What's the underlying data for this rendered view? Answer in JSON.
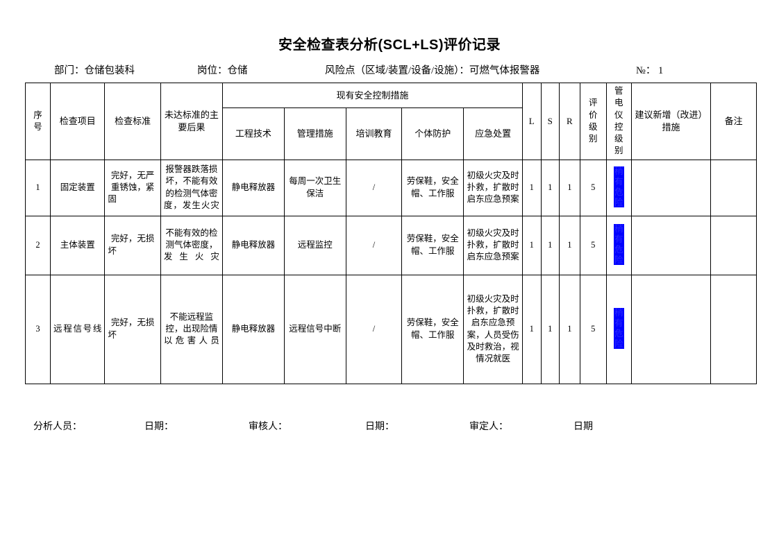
{
  "document": {
    "title": "安全检查表分析(SCL+LS)评价记录"
  },
  "info": {
    "department_label": "部门：仓储包装科",
    "post_label": "岗位：仓储",
    "risk_point_label": "风险点（区域/装置/设备/设施）：可燃气体报警器",
    "number_label": "№：  1"
  },
  "table": {
    "headers": {
      "no": "序号",
      "check_item": "检查项目",
      "check_standard": "检查标准",
      "consequence": "未达标准的主要后果",
      "control_measures_group": "现有安全控制措施",
      "engineering": "工程技术",
      "management": "管理措施",
      "training": "培训教育",
      "ppe": "个体防护",
      "emergency": "应急处置",
      "l": "L",
      "s": "S",
      "r": "R",
      "eval_grade": "评价级别",
      "control_grade": "管电仪控级别",
      "suggestion": "建议新增（改进）措施",
      "remark": "备注"
    },
    "rows": [
      {
        "no": "1",
        "check_item": "固定装置",
        "check_standard": "完好，无严重锈蚀，紧固",
        "consequence": "报警器跌落损坏，不能有效的检测气体密度，发生火灾",
        "engineering": "静电释放器",
        "management": "每周一次卫生保洁",
        "training": "/",
        "ppe": "劳保鞋，安全帽、工作服",
        "emergency": "初级火灾及时扑救，扩散时启东应急预案",
        "l": "1",
        "s": "1",
        "r": "1",
        "eval_grade": "5",
        "control_grade": "稍有危险",
        "suggestion": "",
        "remark": ""
      },
      {
        "no": "2",
        "check_item": "主体装置",
        "check_standard": "完好，无损坏",
        "consequence": "不能有效的检测气体密度，发生火灾",
        "engineering": "静电释放器",
        "management": "远程监控",
        "training": "/",
        "ppe": "劳保鞋，安全帽、工作服",
        "emergency": "初级火灾及时扑救，扩散时启东应急预案",
        "l": "1",
        "s": "1",
        "r": "1",
        "eval_grade": "5",
        "control_grade": "稍有危险",
        "suggestion": "",
        "remark": ""
      },
      {
        "no": "3",
        "check_item": "远程信号线",
        "check_standard": "完好，无损坏",
        "consequence": "不能远程监控，出现险情以危害人员",
        "engineering": "静电释放器",
        "management": "远程信号中断",
        "training": "/",
        "ppe": "劳保鞋，安全帽、工作服",
        "emergency": "初级火灾及时扑救，扩散时启东应急预案，人员受伤及时救治，视情况就医",
        "l": "1",
        "s": "1",
        "r": "1",
        "eval_grade": "5",
        "control_grade": "稍有危险",
        "suggestion": "",
        "remark": ""
      }
    ]
  },
  "footer": {
    "analyst_label": "分析人员：",
    "date_label_1": "日期：",
    "reviewer_label": "审核人：",
    "date_label_2": "日期：",
    "approver_label": "审定人：",
    "date_label_3": "日期"
  },
  "colors": {
    "badge_background": "#0000ff",
    "badge_text": "#2a2aff",
    "border": "#000000",
    "page_background": "#ffffff"
  }
}
